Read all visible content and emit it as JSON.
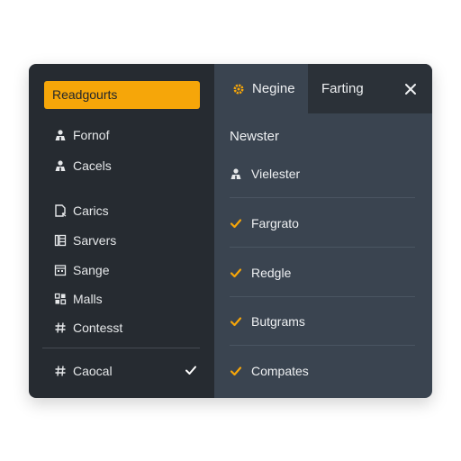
{
  "colors": {
    "accent": "#f6a609",
    "sidebar_bg": "#262b31",
    "panel_bg": "#3a4450",
    "tabbar_bg": "#2b3138",
    "text": "#e6e8ea"
  },
  "sidebar": {
    "header_label": "Readgourts",
    "items": [
      {
        "label": "Fornof",
        "icon": "user-icon"
      },
      {
        "label": "Cacels",
        "icon": "user-icon"
      },
      {
        "label": "Carics",
        "icon": "document-icon"
      },
      {
        "label": "Sarvers",
        "icon": "server-icon"
      },
      {
        "label": "Sange",
        "icon": "calendar-icon"
      },
      {
        "label": "Malls",
        "icon": "grid-icon"
      },
      {
        "label": "Contesst",
        "icon": "hash-icon"
      }
    ],
    "footer": {
      "label": "Caocal",
      "icon": "hash-icon",
      "checked": true
    }
  },
  "tabs": {
    "active_label": "Negine",
    "active_icon": "gear-icon",
    "second_label": "Farting",
    "close_icon": "close-icon"
  },
  "panel": {
    "section_title": "Newster",
    "items": [
      {
        "label": "Vielester",
        "icon": "user-icon"
      },
      {
        "label": "Fargrato",
        "icon": "check-icon"
      },
      {
        "label": "Redgle",
        "icon": "check-icon"
      },
      {
        "label": "Butgrams",
        "icon": "check-icon"
      },
      {
        "label": "Compates",
        "icon": "check-icon"
      }
    ]
  }
}
